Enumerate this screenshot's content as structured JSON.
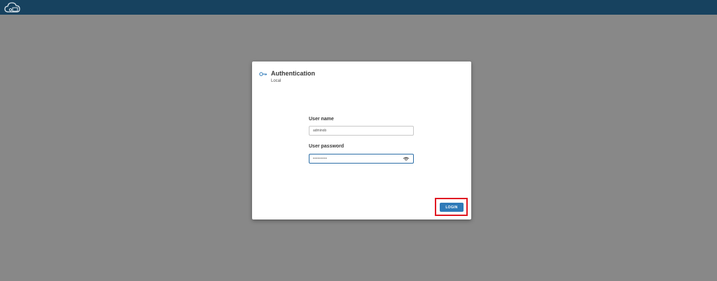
{
  "dialog": {
    "title": "Authentication",
    "subtitle": "Local",
    "username": {
      "label": "User name",
      "value": "adminob"
    },
    "password": {
      "label": "User password",
      "value": "•••••••••"
    },
    "login_label": "LOGIN"
  },
  "icons": {
    "app": "cloud-logo-icon",
    "title": "key-icon",
    "password_toggle": "eye-icon"
  },
  "colors": {
    "topbar": "#17425f",
    "backdrop": "#888888",
    "accent": "#2f7ab8",
    "highlight": "#e01822"
  }
}
